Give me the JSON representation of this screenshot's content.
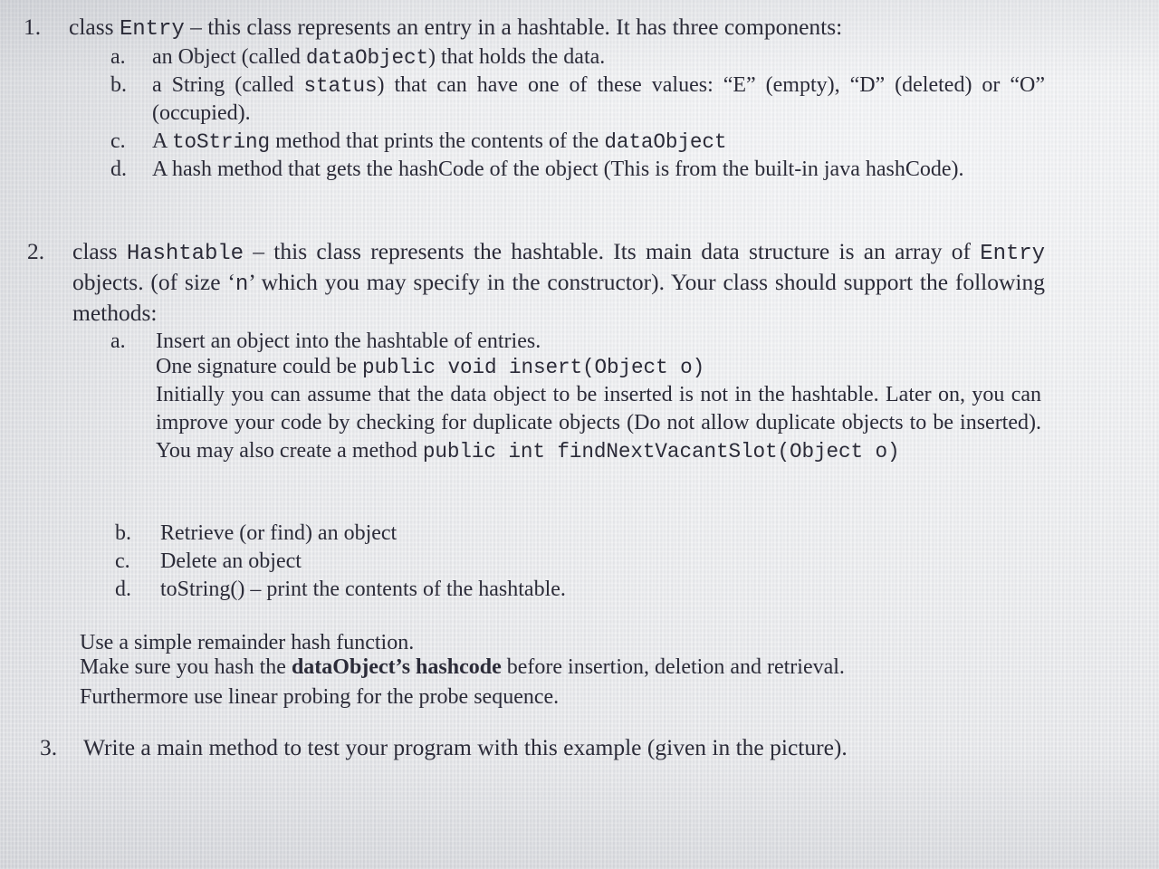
{
  "document": {
    "kind": "scanned-assignment-handout",
    "paper_color": "#e9eaec",
    "ink_color": "#2b2b38",
    "items": [
      {
        "marker": "1.",
        "lead": {
          "segments": [
            {
              "text": "class ",
              "style": "serif"
            },
            {
              "text": "Entry",
              "style": "mono"
            },
            {
              "text": " – this class represents an entry in a hashtable. It has three components:",
              "style": "serif"
            }
          ]
        },
        "subitems": [
          {
            "marker": "a.",
            "segments": [
              {
                "text": "an Object (called ",
                "style": "serif"
              },
              {
                "text": "dataObject",
                "style": "mono"
              },
              {
                "text": ") that holds the data.",
                "style": "serif"
              }
            ]
          },
          {
            "marker": "b.",
            "segments": [
              {
                "text": "a String (called ",
                "style": "serif"
              },
              {
                "text": "status",
                "style": "mono"
              },
              {
                "text": ") that can have one of these values: “E” (empty), “D” (deleted) or “O” (occupied).",
                "style": "serif"
              }
            ]
          },
          {
            "marker": "c.",
            "segments": [
              {
                "text": "A ",
                "style": "serif"
              },
              {
                "text": "toString",
                "style": "mono"
              },
              {
                "text": " method that prints the contents of the ",
                "style": "serif"
              },
              {
                "text": "dataObject",
                "style": "mono"
              }
            ]
          },
          {
            "marker": "d.",
            "segments": [
              {
                "text": "A hash method that gets the hashCode of the object (This is from the built-in java hashCode).",
                "style": "serif"
              }
            ]
          }
        ]
      },
      {
        "marker": "2.",
        "lead": {
          "segments": [
            {
              "text": "class ",
              "style": "serif"
            },
            {
              "text": "Hashtable",
              "style": "mono"
            },
            {
              "text": " – this class represents the hashtable. Its main data structure is an array of ",
              "style": "serif"
            },
            {
              "text": "Entry",
              "style": "mono"
            },
            {
              "text": " objects. (of size ‘",
              "style": "serif"
            },
            {
              "text": "n",
              "style": "mono"
            },
            {
              "text": "’ which you may specify in the constructor). Your class should support the following methods:",
              "style": "serif"
            }
          ]
        },
        "subitems": [
          {
            "marker": "a.",
            "segments": [
              {
                "text": "Insert an object into the hashtable of entries.",
                "style": "serif"
              }
            ],
            "extra_lines": [
              {
                "id": "signature",
                "segments": [
                  {
                    "text": "One signature could be ",
                    "style": "serif"
                  },
                  {
                    "text": "public void insert(Object o)",
                    "style": "mono"
                  }
                ]
              },
              {
                "id": "note",
                "segments": [
                  {
                    "text": "Initially you can assume that the data object to be inserted is not in the hashtable. Later on, you can improve your code by checking for duplicate objects (Do not allow duplicate objects to be inserted). You may also create a method ",
                    "style": "serif"
                  },
                  {
                    "text": "public int findNextVacantSlot(Object o)",
                    "style": "mono"
                  }
                ]
              }
            ]
          },
          {
            "marker": "b.",
            "segments": [
              {
                "text": "Retrieve (or find) an object",
                "style": "serif"
              }
            ]
          },
          {
            "marker": "c.",
            "segments": [
              {
                "text": "Delete an object",
                "style": "serif"
              }
            ]
          },
          {
            "marker": "d.",
            "segments": [
              {
                "text": "toString() – print the contents of the hashtable.",
                "style": "serif"
              }
            ]
          }
        ]
      },
      {
        "marker": "3.",
        "lead": {
          "segments": [
            {
              "text": "Write a main method to test your program with this example (given in the picture).",
              "style": "serif"
            }
          ]
        },
        "subitems": []
      }
    ],
    "trailing_paragraphs": [
      {
        "id": "hash-function",
        "segments": [
          {
            "text": "Use a simple remainder hash function.",
            "style": "serif"
          }
        ]
      },
      {
        "id": "hash-before-ops",
        "segments": [
          {
            "text": "Make sure you hash the ",
            "style": "serif"
          },
          {
            "text": "dataObject’s hashcode",
            "style": "serif-bold"
          },
          {
            "text": " before insertion, deletion and retrieval.",
            "style": "serif"
          }
        ]
      },
      {
        "id": "linear-probing",
        "segments": [
          {
            "text": "Furthermore use linear probing for the probe sequence.",
            "style": "serif"
          }
        ]
      }
    ],
    "plain_text": {
      "item1_marker": "1.",
      "item1_lead_part1": "class ",
      "item1_lead_mono": "Entry",
      "item1_lead_part2": " – this class represents an entry in a hashtable. It has three components:",
      "item1a_marker": "a.",
      "item1a_part1": "an Object (called ",
      "item1a_mono": "dataObject",
      "item1a_part2": ") that holds the data.",
      "item1b_marker": "b.",
      "item1b_part1": "a String (called ",
      "item1b_mono": "status",
      "item1b_part2": ") that can have one of these values: “E” (empty), “D” (deleted) or “O” (occupied).",
      "item1c_marker": "c.",
      "item1c_part1": "A ",
      "item1c_mono1": "toString",
      "item1c_part2": " method that prints the contents of the ",
      "item1c_mono2": "dataObject",
      "item1d_marker": "d.",
      "item1d_text": "A hash method that gets the hashCode of the object (This is from the built-in java hashCode).",
      "item2_marker": "2.",
      "item2_part1": "class ",
      "item2_mono1": "Hashtable",
      "item2_part2": " – this class represents the hashtable. Its main data structure is an array of ",
      "item2_mono2": "Entry",
      "item2_part3": " objects. (of size ‘",
      "item2_mono3": "n",
      "item2_part4": "’ which you may specify in the constructor). Your class should support the following methods:",
      "item2a_marker": "a.",
      "item2a_text": "Insert an object into the hashtable of entries.",
      "item2a_sig_part1": "One signature could be ",
      "item2a_sig_mono": "public void insert(Object o)",
      "item2a_note_part1": "Initially you can assume that the data object to be inserted is not in the hashtable. Later on, you can improve your code by checking for duplicate objects (Do not allow duplicate objects to be inserted). You may also create a method ",
      "item2a_note_mono": "public int findNextVacantSlot(Object o)",
      "item2b_marker": "b.",
      "item2b_text": "Retrieve (or find) an object",
      "item2c_marker": "c.",
      "item2c_text": "Delete an object",
      "item2d_marker": "d.",
      "item2d_text": "toString() – print the contents of the hashtable.",
      "hash1_text": "Use a simple remainder hash function.",
      "hash2_part1": "Make sure you hash the ",
      "hash2_bold": "dataObject’s hashcode",
      "hash2_part2": " before insertion, deletion and retrieval.",
      "hash3_text": "Furthermore use linear probing for the probe sequence.",
      "item3_marker": "3.",
      "item3_text": "Write a main method to test your program with this example (given in the picture)."
    }
  }
}
